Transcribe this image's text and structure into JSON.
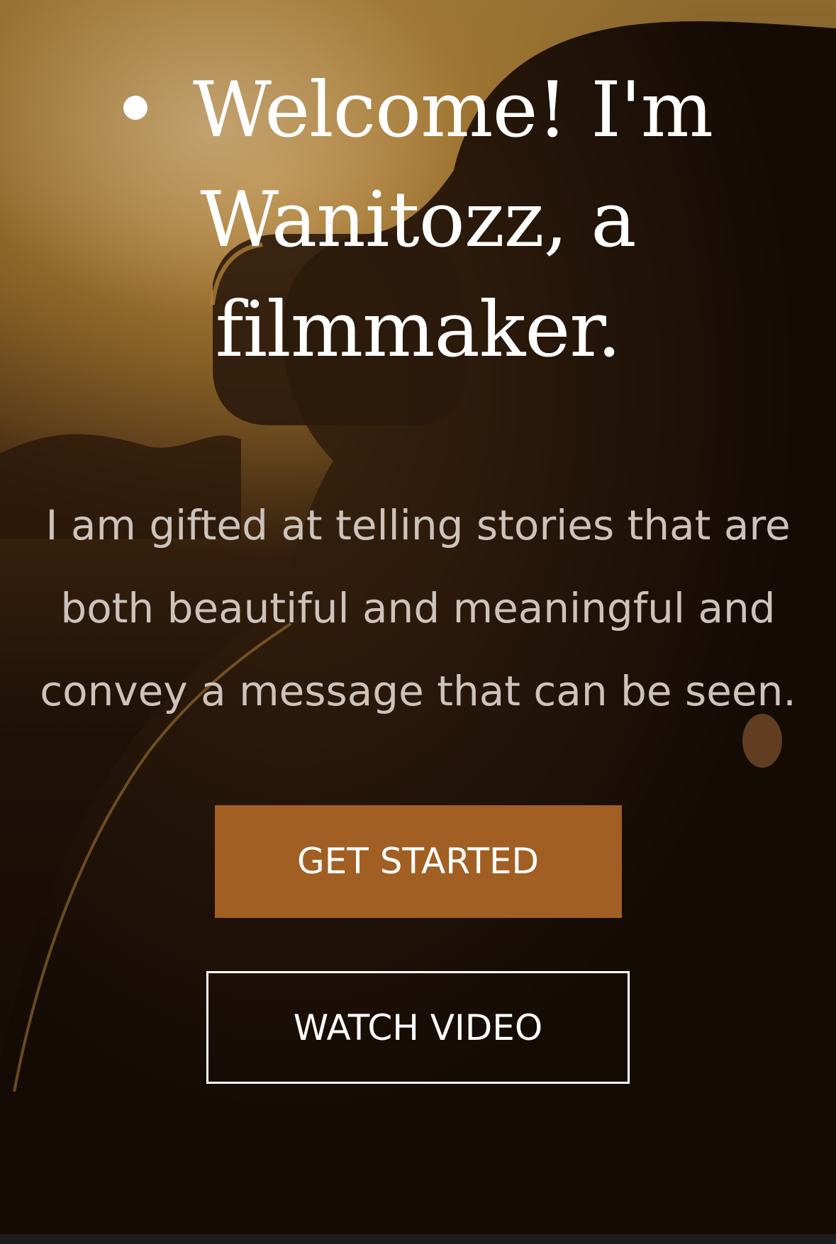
{
  "hero": {
    "headline": "Welcome! I'm Wanitozz, a filmmaker.",
    "tagline": "I am gifted at telling stories that are both beautiful and meaningful and convey a message that can be seen.",
    "primary_button_label": "GET STARTED",
    "secondary_button_label": "WATCH VIDEO",
    "bullet_icon": "bullet-dot-icon",
    "background_image": "photographer-silhouette-sunset"
  },
  "colors": {
    "primary_button": "#a15f23",
    "headline_text": "#ffffff",
    "tagline_text": "#cdc3bb",
    "background_dark": "#140b05"
  }
}
